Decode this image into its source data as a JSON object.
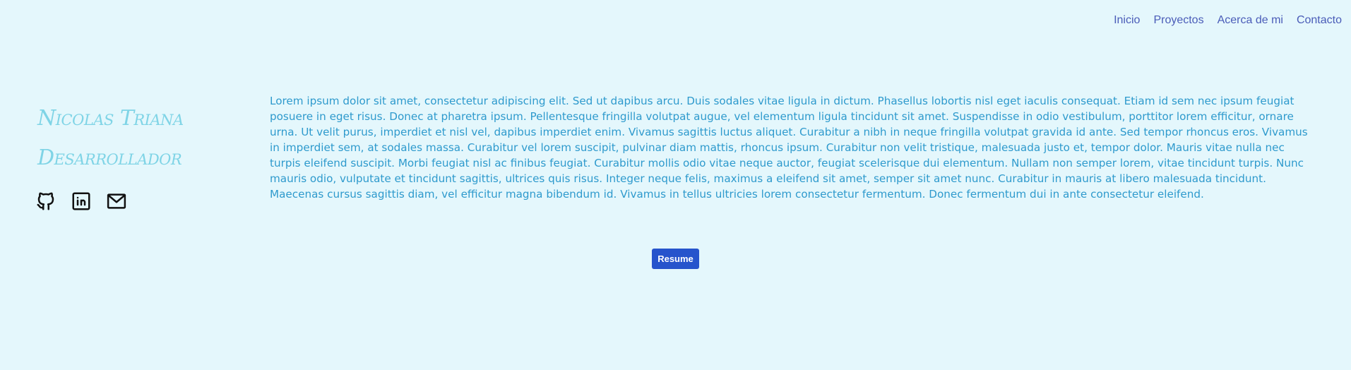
{
  "nav": {
    "items": [
      {
        "label": "Inicio"
      },
      {
        "label": "Proyectos"
      },
      {
        "label": "Acerca de mi"
      },
      {
        "label": "Contacto"
      }
    ]
  },
  "profile": {
    "name": "Nicolas Triana",
    "role": "Desarrollador",
    "socials": [
      {
        "icon": "github-icon"
      },
      {
        "icon": "linkedin-icon"
      },
      {
        "icon": "mail-icon"
      }
    ]
  },
  "bio": {
    "text": "Lorem ipsum dolor sit amet, consectetur adipiscing elit. Sed ut dapibus arcu. Duis sodales vitae ligula in dictum. Phasellus lobortis nisl eget iaculis consequat. Etiam id sem nec ipsum feugiat posuere in eget risus. Donec at pharetra ipsum. Pellentesque fringilla volutpat augue, vel elementum ligula tincidunt sit amet. Suspendisse in odio vestibulum, porttitor lorem efficitur, ornare urna. Ut velit purus, imperdiet et nisl vel, dapibus imperdiet enim. Vivamus sagittis luctus aliquet. Curabitur a nibh in neque fringilla volutpat gravida id ante. Sed tempor rhoncus eros. Vivamus in imperdiet sem, at sodales massa. Curabitur vel lorem suscipit, pulvinar diam mattis, rhoncus ipsum. Curabitur non velit tristique, malesuada justo et, tempor dolor. Mauris vitae nulla nec turpis eleifend suscipit. Morbi feugiat nisl ac finibus feugiat. Curabitur mollis odio vitae neque auctor, feugiat scelerisque dui elementum. Nullam non semper lorem, vitae tincidunt turpis. Nunc mauris odio, vulputate et tincidunt sagittis, ultrices quis risus. Integer neque felis, maximus a eleifend sit amet, semper sit amet nunc. Curabitur in mauris at libero malesuada tincidunt. Maecenas cursus sagittis diam, vel efficitur magna bibendum id. Vivamus in tellus ultricies lorem consectetur fermentum. Donec fermentum dui in ante consectetur eleifend."
  },
  "resume": {
    "label": "Resume"
  },
  "colors": {
    "background": "#e4f7fc",
    "nav_link": "#4a5cb8",
    "name": "#7fd4e6",
    "bio_text": "#2e9acd",
    "button": "#2654cc"
  }
}
